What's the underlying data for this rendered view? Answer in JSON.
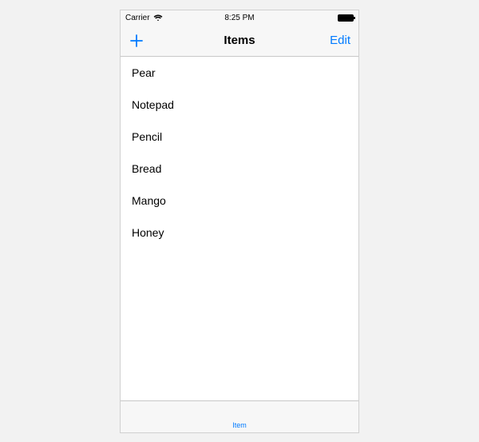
{
  "status_bar": {
    "carrier": "Carrier",
    "time": "8:25 PM"
  },
  "nav": {
    "title": "Items",
    "edit_label": "Edit"
  },
  "items": [
    "Pear",
    "Notepad",
    "Pencil",
    "Bread",
    "Mango",
    "Honey"
  ],
  "tab": {
    "label": "Item"
  }
}
